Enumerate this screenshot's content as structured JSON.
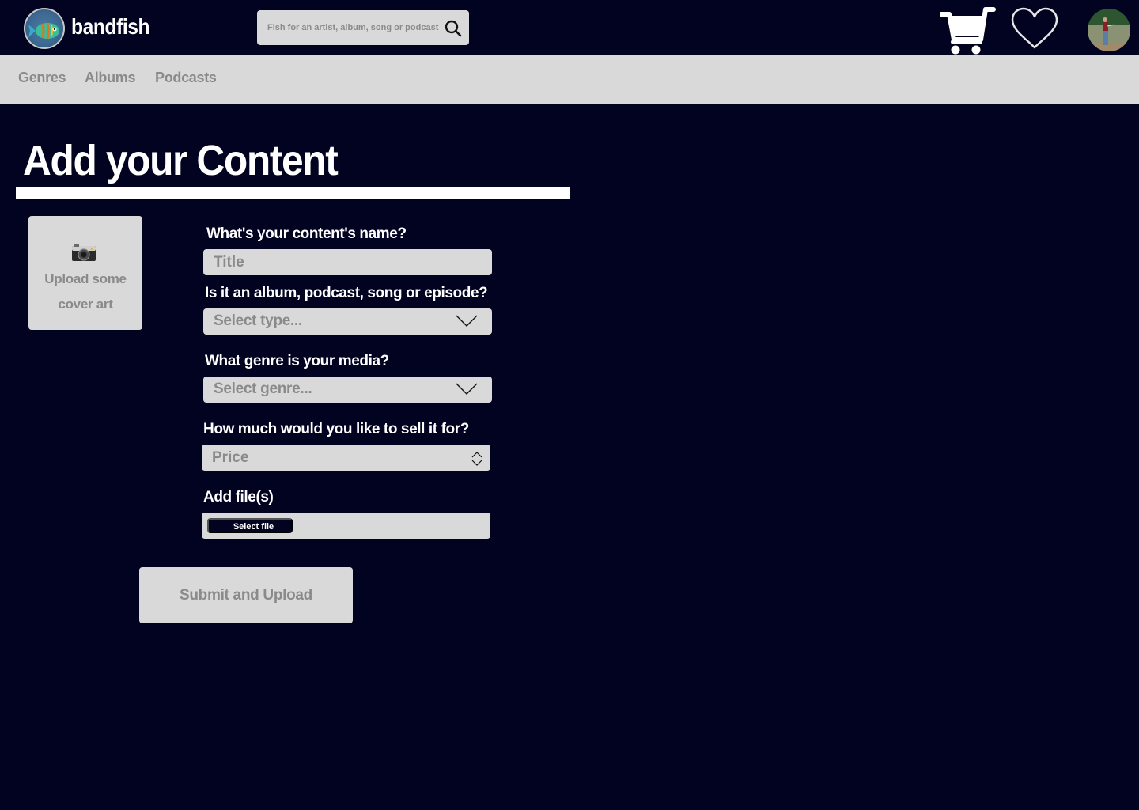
{
  "brand": {
    "name": "bandfish",
    "logo_icon": "fish-logo-icon"
  },
  "search": {
    "placeholder": "Fish for an artist, album, song or podcast",
    "icon": "search-icon"
  },
  "header_actions": {
    "cart_icon": "cart-icon",
    "favorites_icon": "heart-icon",
    "avatar": "user-avatar"
  },
  "nav": {
    "items": [
      {
        "label": "Genres"
      },
      {
        "label": "Albums"
      },
      {
        "label": "Podcasts"
      }
    ]
  },
  "page": {
    "title": "Add your Content"
  },
  "cover_art": {
    "icon": "camera-icon",
    "label_line1": "Upload some",
    "label_line2": "cover art"
  },
  "form": {
    "name": {
      "question": "What's your content's name?",
      "placeholder": "Title",
      "value": ""
    },
    "type": {
      "question": "Is it an album, podcast, song or episode?",
      "selected": "Select type..."
    },
    "genre": {
      "question": "What genre is your media?",
      "selected": "Select genre..."
    },
    "price": {
      "question": "How much would you like to sell it for?",
      "placeholder": "Price",
      "value": ""
    },
    "files": {
      "question": "Add file(s)",
      "button_label": "Select file"
    },
    "submit_label": "Submit and Upload"
  },
  "colors": {
    "background": "#020320",
    "surface": "#d9d9d9",
    "muted_text": "#8a8a8a",
    "text": "#ffffff"
  }
}
